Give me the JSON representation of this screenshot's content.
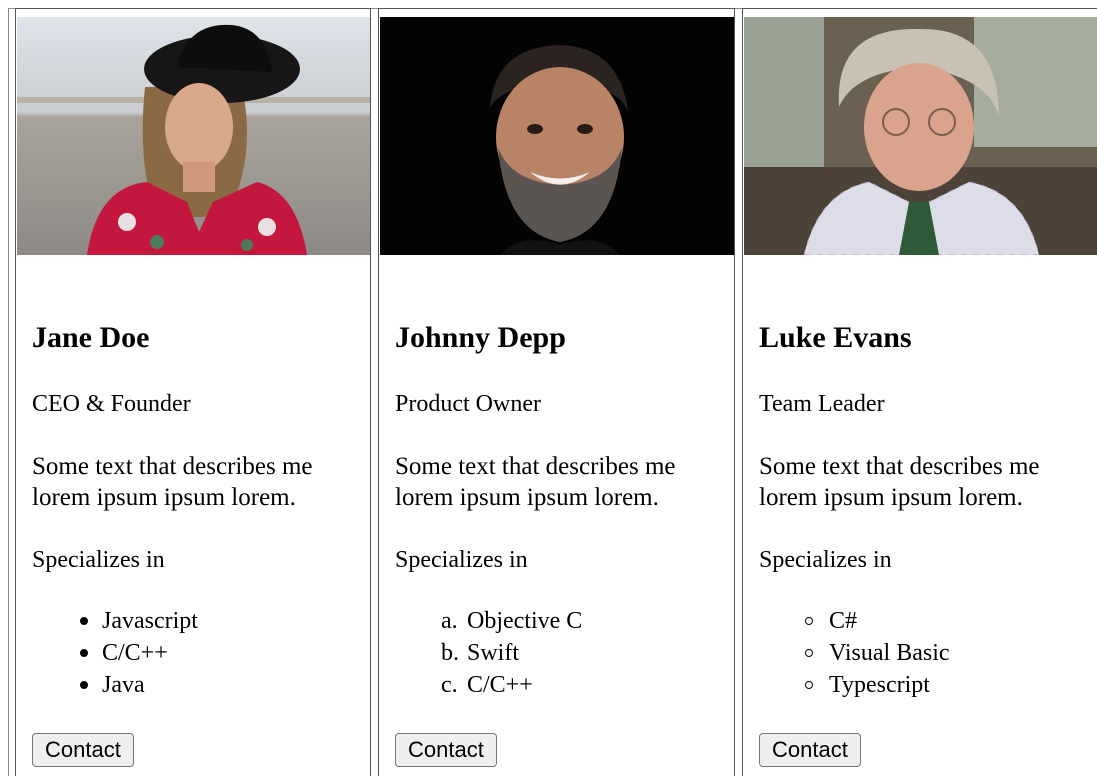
{
  "cards": [
    {
      "name": "Jane Doe",
      "role": "CEO & Founder",
      "description": "Some text that describes me lorem ipsum ipsum lorem.",
      "specializes_label": "Specializes in",
      "list_style": "disc",
      "skills": [
        "Javascript",
        "C/C++",
        "Java"
      ],
      "contact_label": "Contact",
      "photo": "woman-in-black-hat-photo"
    },
    {
      "name": "Johnny Depp",
      "role": "Product Owner",
      "description": "Some text that describes me lorem ipsum ipsum lorem.",
      "specializes_label": "Specializes in",
      "list_style": "lower-alpha",
      "skill_markers": [
        "a.",
        "b.",
        "c."
      ],
      "skills": [
        "Objective C",
        "Swift",
        "C/C++"
      ],
      "contact_label": "Contact",
      "photo": "smiling-bearded-man-photo"
    },
    {
      "name": "Luke Evans",
      "role": "Team Leader",
      "description": "Some text that describes me lorem ipsum ipsum lorem.",
      "specializes_label": "Specializes in",
      "list_style": "circle",
      "skills": [
        "C#",
        "Visual Basic",
        "Typescript"
      ],
      "contact_label": "Contact",
      "photo": "older-man-with-tie-photo"
    }
  ]
}
